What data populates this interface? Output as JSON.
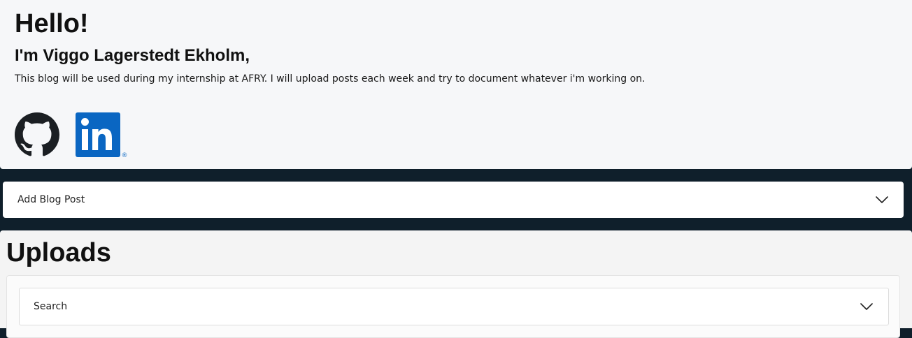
{
  "hero": {
    "greeting": "Hello!",
    "intro": "I'm Viggo Lagerstedt Ekholm,",
    "description": "This blog will be used during my internship at AFRY. I will upload posts each week and try to document whatever i'm working on.",
    "socials": [
      {
        "icon": "github-icon"
      },
      {
        "icon": "linkedin-icon",
        "text": "in",
        "mark": "®"
      }
    ]
  },
  "add_post": {
    "label": "Add Blog Post",
    "icon": "chevron-down-icon"
  },
  "uploads": {
    "title": "Uploads",
    "search": {
      "label": "Search",
      "icon": "chevron-down-icon"
    }
  },
  "colors": {
    "hero_bg": "#f6f7f9",
    "band_bg": "#0f1f2b",
    "linkedin_blue": "#0a66c2",
    "github_black": "#1b1f23"
  }
}
